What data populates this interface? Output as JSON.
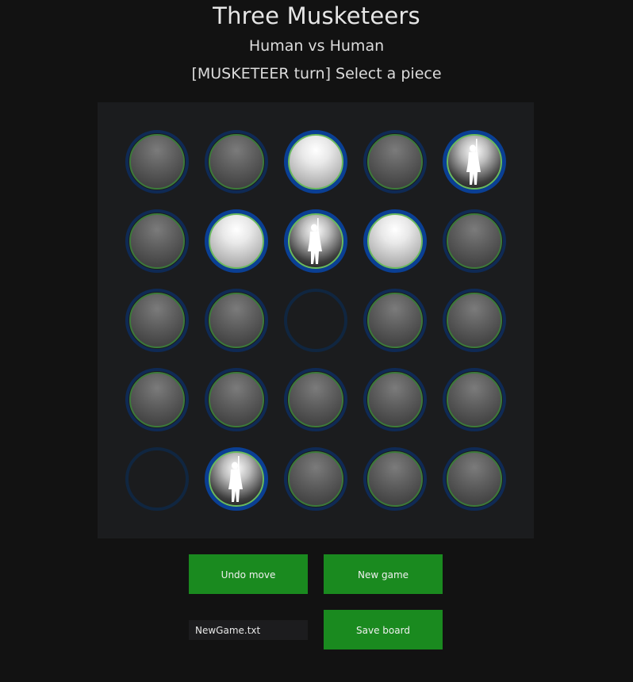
{
  "header": {
    "title": "Three Musketeers",
    "subtitle": "Human vs Human",
    "status": "[MUSKETEER turn] Select a piece"
  },
  "board": {
    "rows": [
      [
        "enemy",
        "enemy",
        "enemy-highlight",
        "enemy",
        "musketeer"
      ],
      [
        "enemy",
        "enemy-highlight",
        "musketeer",
        "enemy-highlight",
        "enemy"
      ],
      [
        "enemy",
        "enemy",
        "empty",
        "enemy",
        "enemy"
      ],
      [
        "enemy",
        "enemy",
        "enemy",
        "enemy",
        "enemy"
      ],
      [
        "empty",
        "musketeer",
        "enemy",
        "enemy",
        "enemy"
      ]
    ]
  },
  "controls": {
    "undo_label": "Undo move",
    "new_game_label": "New game",
    "save_label": "Save board",
    "filename_value": "NewGame.txt"
  },
  "colors": {
    "button_bg": "#1a8a1f",
    "ring_highlight": "#0a3f94",
    "page_bg": "#121212"
  }
}
